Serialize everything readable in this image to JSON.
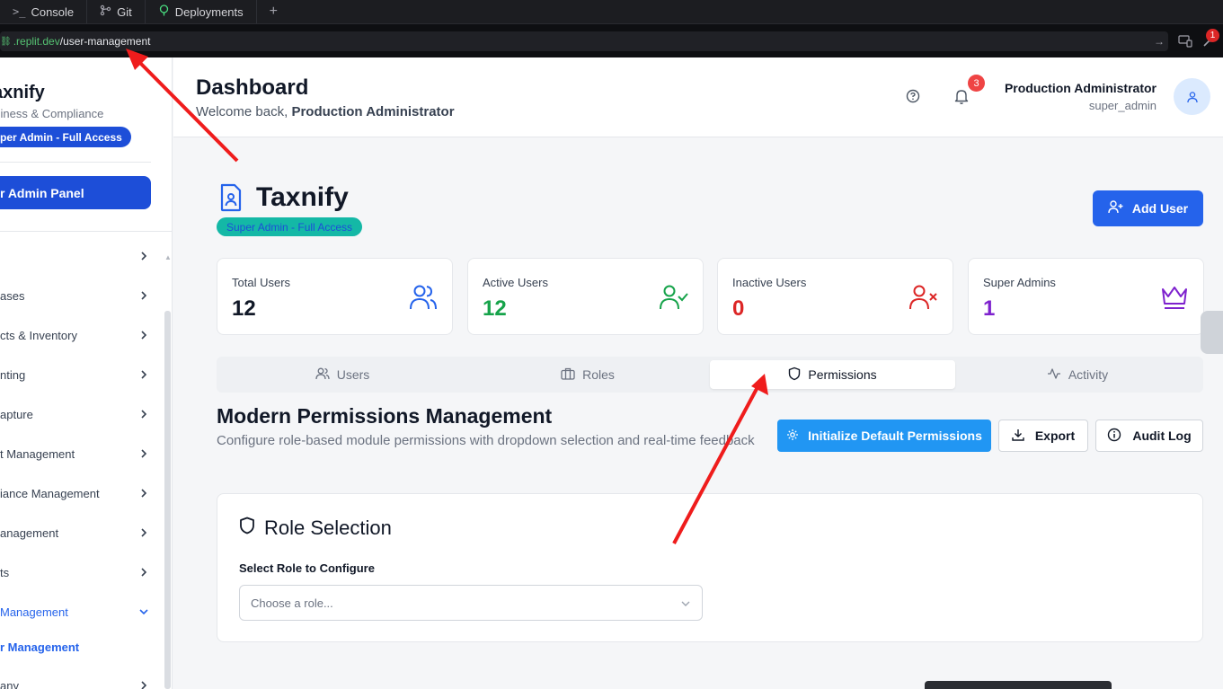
{
  "tabs": [
    {
      "icon": ">_",
      "label": "Console"
    },
    {
      "icon": "git-icon",
      "label": "Git"
    },
    {
      "icon": "deploy-icon",
      "label": "Deployments"
    }
  ],
  "url": {
    "domain": ".replit.dev",
    "path": "/user-management"
  },
  "url_badge": "1",
  "sidebar": {
    "brand": "axnify",
    "subtitle": "siness & Compliance",
    "pill": "per Admin - Full Access",
    "admin_button": "r Admin Panel",
    "items": [
      {
        "label": ""
      },
      {
        "label": "ases"
      },
      {
        "label": "cts & Inventory"
      },
      {
        "label": "nting"
      },
      {
        "label": "apture"
      },
      {
        "label": "t Management"
      },
      {
        "label": "iance Management"
      },
      {
        "label": "anagement"
      },
      {
        "label": "ts"
      },
      {
        "label": "Management"
      },
      {
        "label": "any"
      }
    ],
    "active_sub": "r Management"
  },
  "header": {
    "title": "Dashboard",
    "welcome_prefix": "Welcome back, ",
    "welcome_name": "Production Administrator",
    "notification_count": "3",
    "user_name": "Production Administrator",
    "user_role": "super_admin"
  },
  "page": {
    "title": "Taxnify",
    "badge": "Super Admin - Full Access",
    "add_user": "Add User"
  },
  "stats": [
    {
      "label": "Total Users",
      "value": "12",
      "color": "#111827",
      "icon": "users-icon"
    },
    {
      "label": "Active Users",
      "value": "12",
      "color": "#16a34a",
      "icon": "user-check-icon"
    },
    {
      "label": "Inactive Users",
      "value": "0",
      "color": "#dc2626",
      "icon": "user-x-icon"
    },
    {
      "label": "Super Admins",
      "value": "1",
      "color": "#7e22ce",
      "icon": "crown-icon"
    }
  ],
  "view_tabs": [
    {
      "label": "Users",
      "icon": "users-icon"
    },
    {
      "label": "Roles",
      "icon": "briefcase-icon"
    },
    {
      "label": "Permissions",
      "icon": "shield-icon"
    },
    {
      "label": "Activity",
      "icon": "activity-icon"
    }
  ],
  "section": {
    "title": "Modern Permissions Management",
    "description": "Configure role-based module permissions with dropdown selection and real-time feedback"
  },
  "actions": {
    "initialize": "Initialize Default Permissions",
    "export": "Export",
    "audit": "Audit Log"
  },
  "role_card": {
    "title": "Role Selection",
    "label": "Select Role to Configure",
    "placeholder": "Choose a role..."
  },
  "colors": {
    "accent": "#2563eb",
    "init_button": "#2196f3",
    "badge_teal": "#14b8a6",
    "annotation_arrow": "#ef1c1c"
  }
}
